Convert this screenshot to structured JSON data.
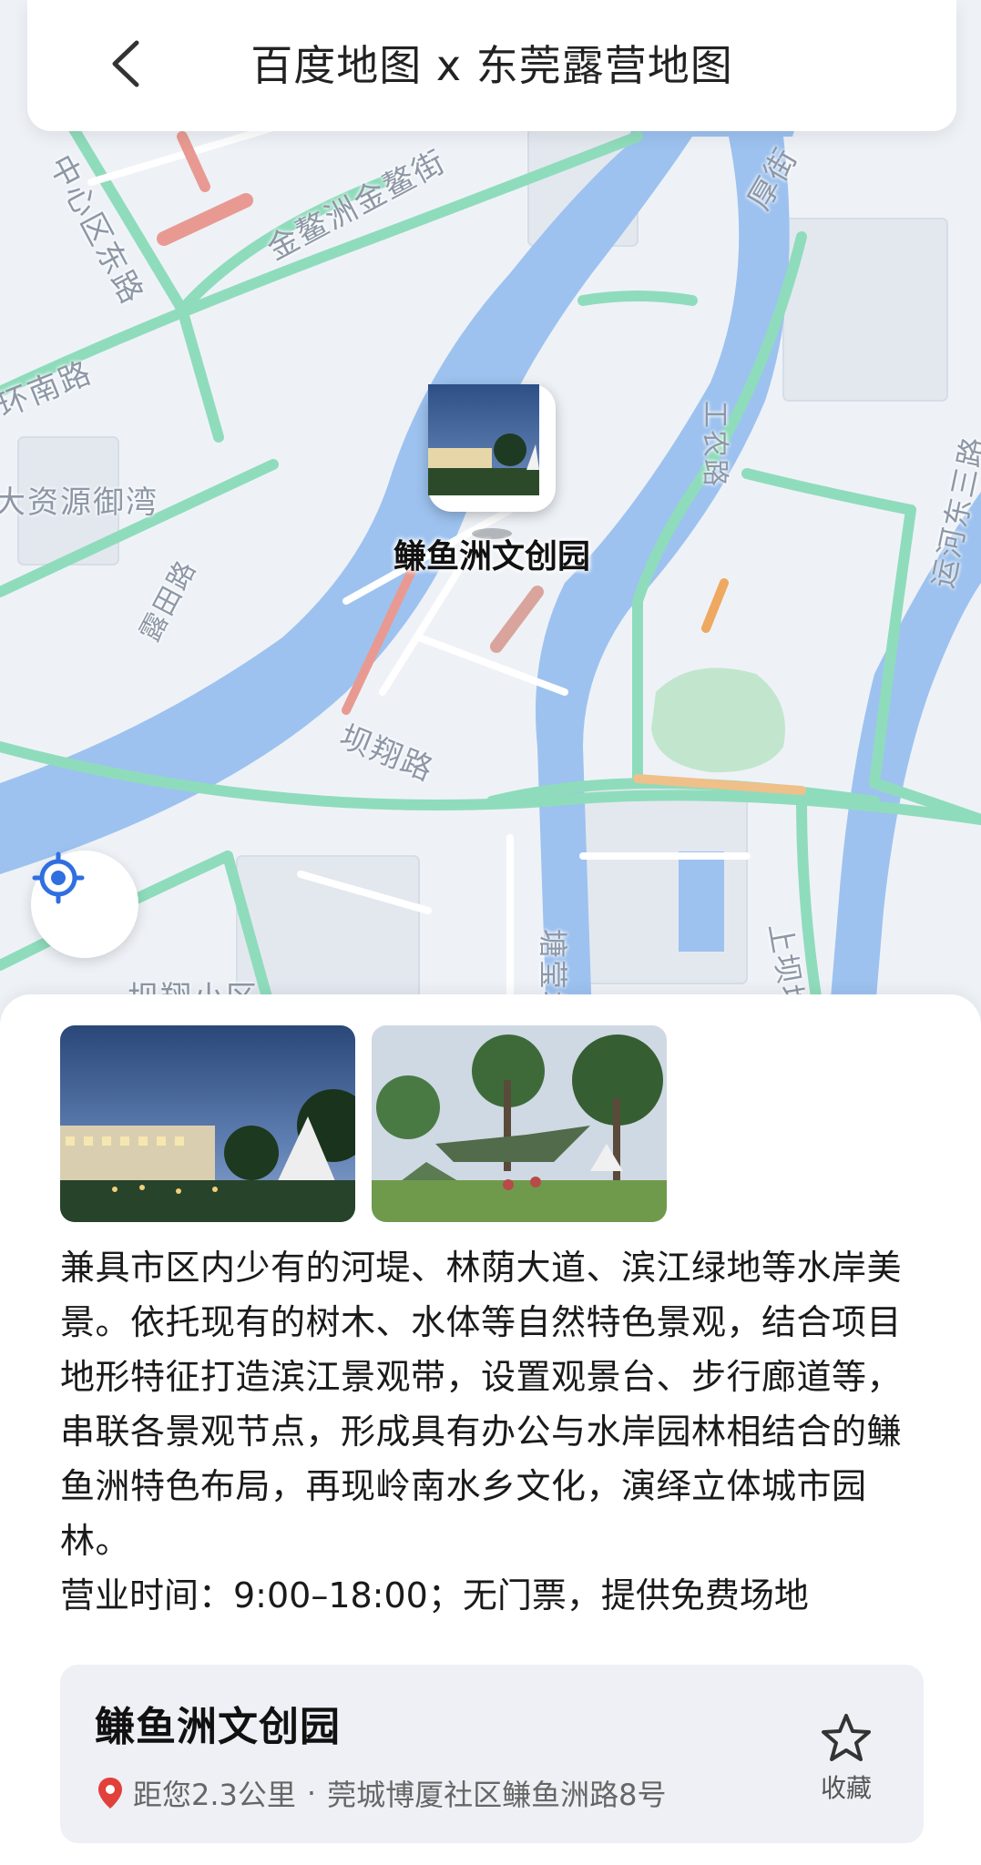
{
  "header": {
    "title": "百度地图 x 东莞露营地图",
    "back_icon": "chevron-left-icon"
  },
  "map": {
    "labels": {
      "jin_ao_zhou": "金鳌洲金鳌街",
      "zhong_xin_qu": "中心区东路",
      "huan_nan": "环南路",
      "da_zi_yuan": "大资源御湾",
      "hou_jie": "厚街",
      "gong_nong": "工农路",
      "ba_xiang": "坝翔路",
      "tang_ying": "塘莹坊",
      "shang_ba": "上坝坊",
      "yun_he_dong": "运河东三路",
      "lu_tian": "露田路",
      "ba_xiang_xiao_qu": "坝翔小区"
    },
    "poi_name": "鳒鱼洲文创园",
    "locate_icon": "locate-icon"
  },
  "sheet": {
    "description": "兼具市区内少有的河堤、林荫大道、滨江绿地等水岸美景。依托现有的树木、水体等自然特色景观，结合项目地形特征打造滨江景观带，设置观景台、步行廊道等，串联各景观节点，形成具有办公与水岸园林相结合的鳒鱼洲特色布局，再现岭南水乡文化，演绎立体城市园林。",
    "hours": "营业时间：9:00–18:00；无门票，提供免费场地",
    "card": {
      "name": "鳒鱼洲文创园",
      "distance": "距您2.3公里",
      "separator": "·",
      "address": "莞城博厦社区鳒鱼洲路8号",
      "fav_label": "收藏",
      "fav_icon": "star-outline-icon",
      "pin_icon": "location-pin-icon"
    }
  },
  "colors": {
    "river": "#9dc2ef",
    "road_green": "#8fdcbc",
    "road_red": "#e89a92",
    "park": "#c2e6cd",
    "accent_blue": "#2f6fe0"
  }
}
